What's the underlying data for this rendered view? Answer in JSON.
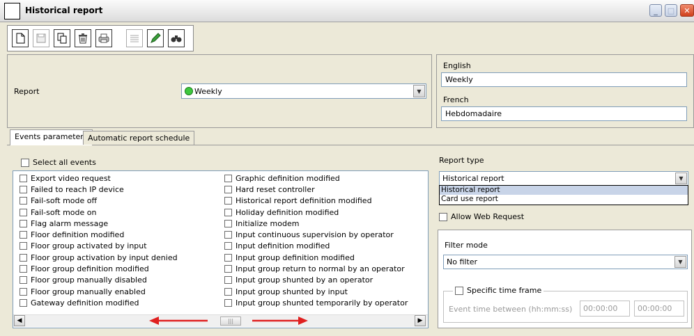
{
  "window": {
    "title": "Historical report"
  },
  "toolbar": {
    "buttons": [
      "new-icon",
      "save-icon",
      "copy-icon",
      "delete-icon",
      "print-icon",
      "list-icon",
      "edit-icon",
      "find-icon"
    ]
  },
  "report": {
    "label": "Report",
    "value": "Weekly",
    "status_color": "#3ec83e"
  },
  "names": {
    "english_label": "English",
    "english_value": "Weekly",
    "french_label": "French",
    "french_value": "Hebdomadaire"
  },
  "tabs": [
    {
      "label": "Events parameters",
      "active": true
    },
    {
      "label": "Automatic report schedule",
      "active": false
    }
  ],
  "events": {
    "select_all_label": "Select all events",
    "column1": [
      "Export video request",
      "Failed to reach IP device",
      "Fail-soft mode off",
      "Fail-soft mode on",
      "Flag alarm message",
      "Floor definition modified",
      "Floor group activated by input",
      "Floor group activation by input denied",
      "Floor group definition modified",
      "Floor group manually disabled",
      "Floor group manually enabled",
      "Gateway definition modified"
    ],
    "column2": [
      "Graphic definition modified",
      "Hard reset controller",
      "Historical report definition modified",
      "Holiday definition modified",
      "Initialize modem",
      "Input continuous supervision by operator",
      "Input definition modified",
      "Input group definition modified",
      "Input group return to normal by an operator",
      "Input group shunted by an operator",
      "Input group shunted by input",
      "Input group shunted temporarily by operator"
    ]
  },
  "report_type": {
    "label": "Report type",
    "value": "Historical report",
    "options": [
      "Historical report",
      "Card use report"
    ]
  },
  "allow_web_request_label": "Allow Web Request",
  "filter": {
    "label": "Filter mode",
    "value": "No filter",
    "specific_time_frame_label": "Specific time frame",
    "event_time_label": "Event time between (hh:mm:ss)",
    "time_from": "00:00:00",
    "time_to": "00:00:00"
  },
  "colors": {
    "arrow_annotation": "#e02020"
  }
}
